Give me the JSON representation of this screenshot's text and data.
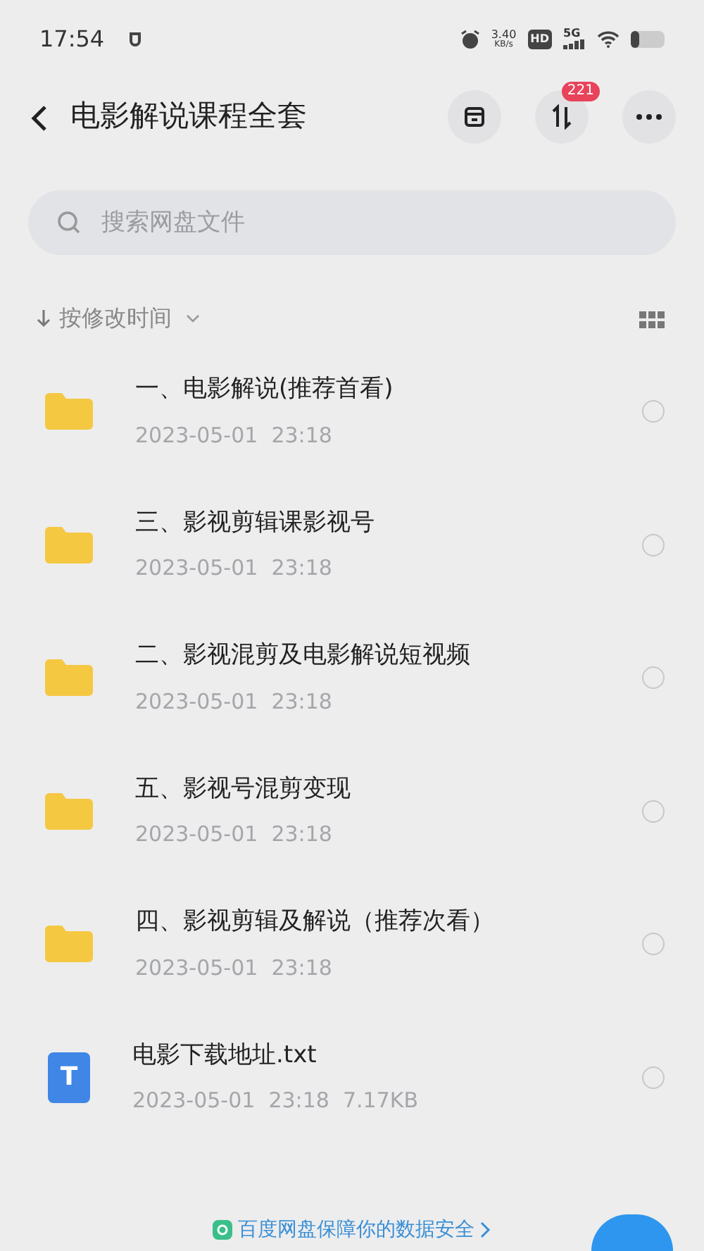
{
  "status_bar": {
    "time": "17:54",
    "net_speed": "3.40",
    "net_unit": "KB/s",
    "hd": "HD",
    "network": "5G"
  },
  "header": {
    "title": "电影解说课程全套",
    "transfer_badge": "221"
  },
  "search": {
    "placeholder": "搜索网盘文件"
  },
  "sort": {
    "label": "按修改时间"
  },
  "files": [
    {
      "kind": "folder",
      "name": "一、电影解说(推荐首看)",
      "date": "2023-05-01  23:18",
      "selected": false
    },
    {
      "kind": "folder",
      "name": "三、影视剪辑课影视号",
      "date": "2023-05-01  23:18",
      "selected": false
    },
    {
      "kind": "folder",
      "name": "二、影视混剪及电影解说短视频",
      "date": "2023-05-01  23:18",
      "selected": false
    },
    {
      "kind": "folder",
      "name": "五、影视号混剪变现",
      "date": "2023-05-01  23:18",
      "selected": false
    },
    {
      "kind": "folder",
      "name": "四、影视剪辑及解说（推荐次看）",
      "date": "2023-05-01  23:18",
      "selected": false
    },
    {
      "kind": "text",
      "name": "电影下载地址.txt",
      "date": "2023-05-01  23:18",
      "size": "7.17KB",
      "icon_letter": "T",
      "selected": false
    }
  ],
  "footer": {
    "notice": "百度网盘保障你的数据安全"
  }
}
